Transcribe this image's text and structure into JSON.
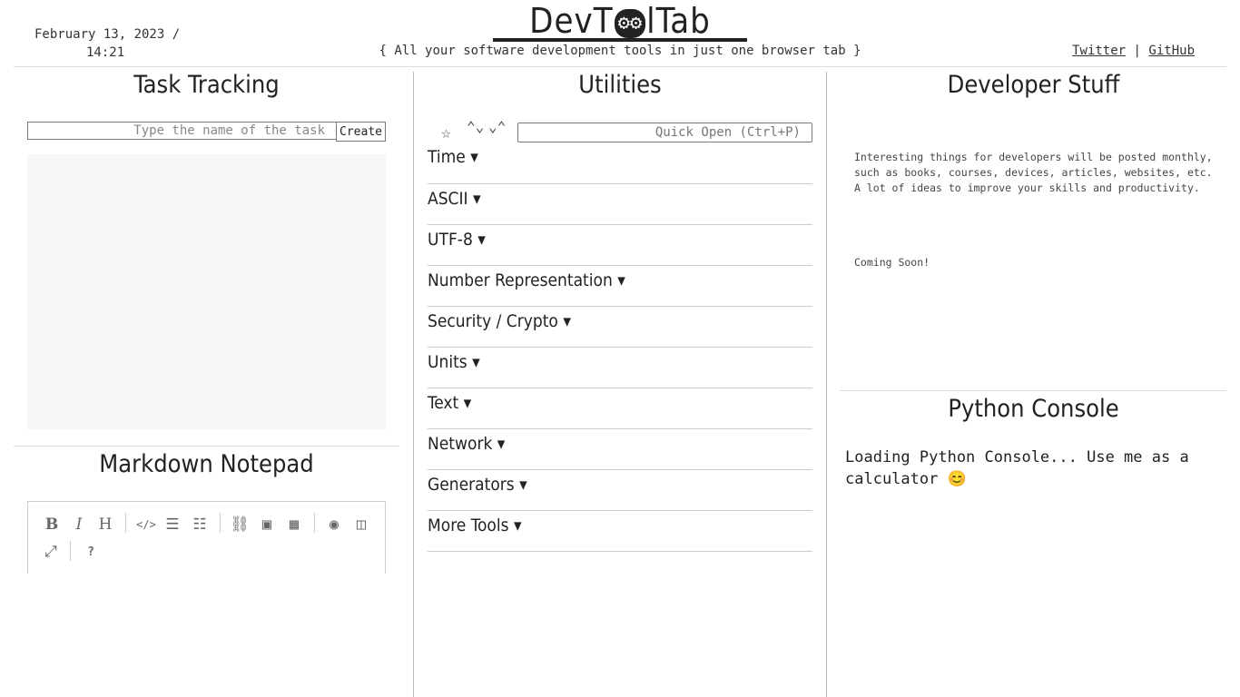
{
  "header": {
    "date_line1": "February 13, 2023 /",
    "date_line2": "14:21",
    "logo_left": "DevT",
    "logo_gears": "⚙⚙",
    "logo_right": "lTab",
    "tagline": "{ All your software development tools in just one browser tab }",
    "links": {
      "twitter": "Twitter",
      "separator": "|",
      "github": "GitHub"
    }
  },
  "task_tracking": {
    "title": "Task Tracking",
    "input_placeholder": "Type the name of the task",
    "create_label": "Create"
  },
  "markdown": {
    "title": "Markdown Notepad",
    "toolbar": {
      "bold": "B",
      "italic": "I",
      "heading": "H",
      "code": "</>",
      "bullet_list": "☰",
      "numbered_list": "☷",
      "link": "⛓",
      "image": "▣",
      "table": "▦",
      "preview": "◉",
      "side_by_side": "◫",
      "fullscreen": "⤢",
      "help": "?"
    }
  },
  "utilities": {
    "title": "Utilities",
    "star_icon": "☆",
    "updown_icon": "⌃⌄",
    "collapse_icon": "⌄⌃",
    "quick_open_placeholder": "Quick Open (Ctrl+P)",
    "categories": [
      "Time ▾",
      "ASCII ▾",
      "UTF-8 ▾",
      "Number Representation ▾",
      "Security / Crypto ▾",
      "Units ▾",
      "Text ▾",
      "Network ▾",
      "Generators ▾",
      "More Tools ▾"
    ]
  },
  "developer_stuff": {
    "title": "Developer Stuff",
    "description": "Interesting things for developers will be posted monthly, such as books, courses, devices, articles, websites, etc. A lot of ideas to improve your skills and productivity.",
    "coming_soon": "Coming Soon!"
  },
  "python_console": {
    "title": "Python Console",
    "loading_text": "Loading Python Console... Use me as a calculator 😊"
  }
}
